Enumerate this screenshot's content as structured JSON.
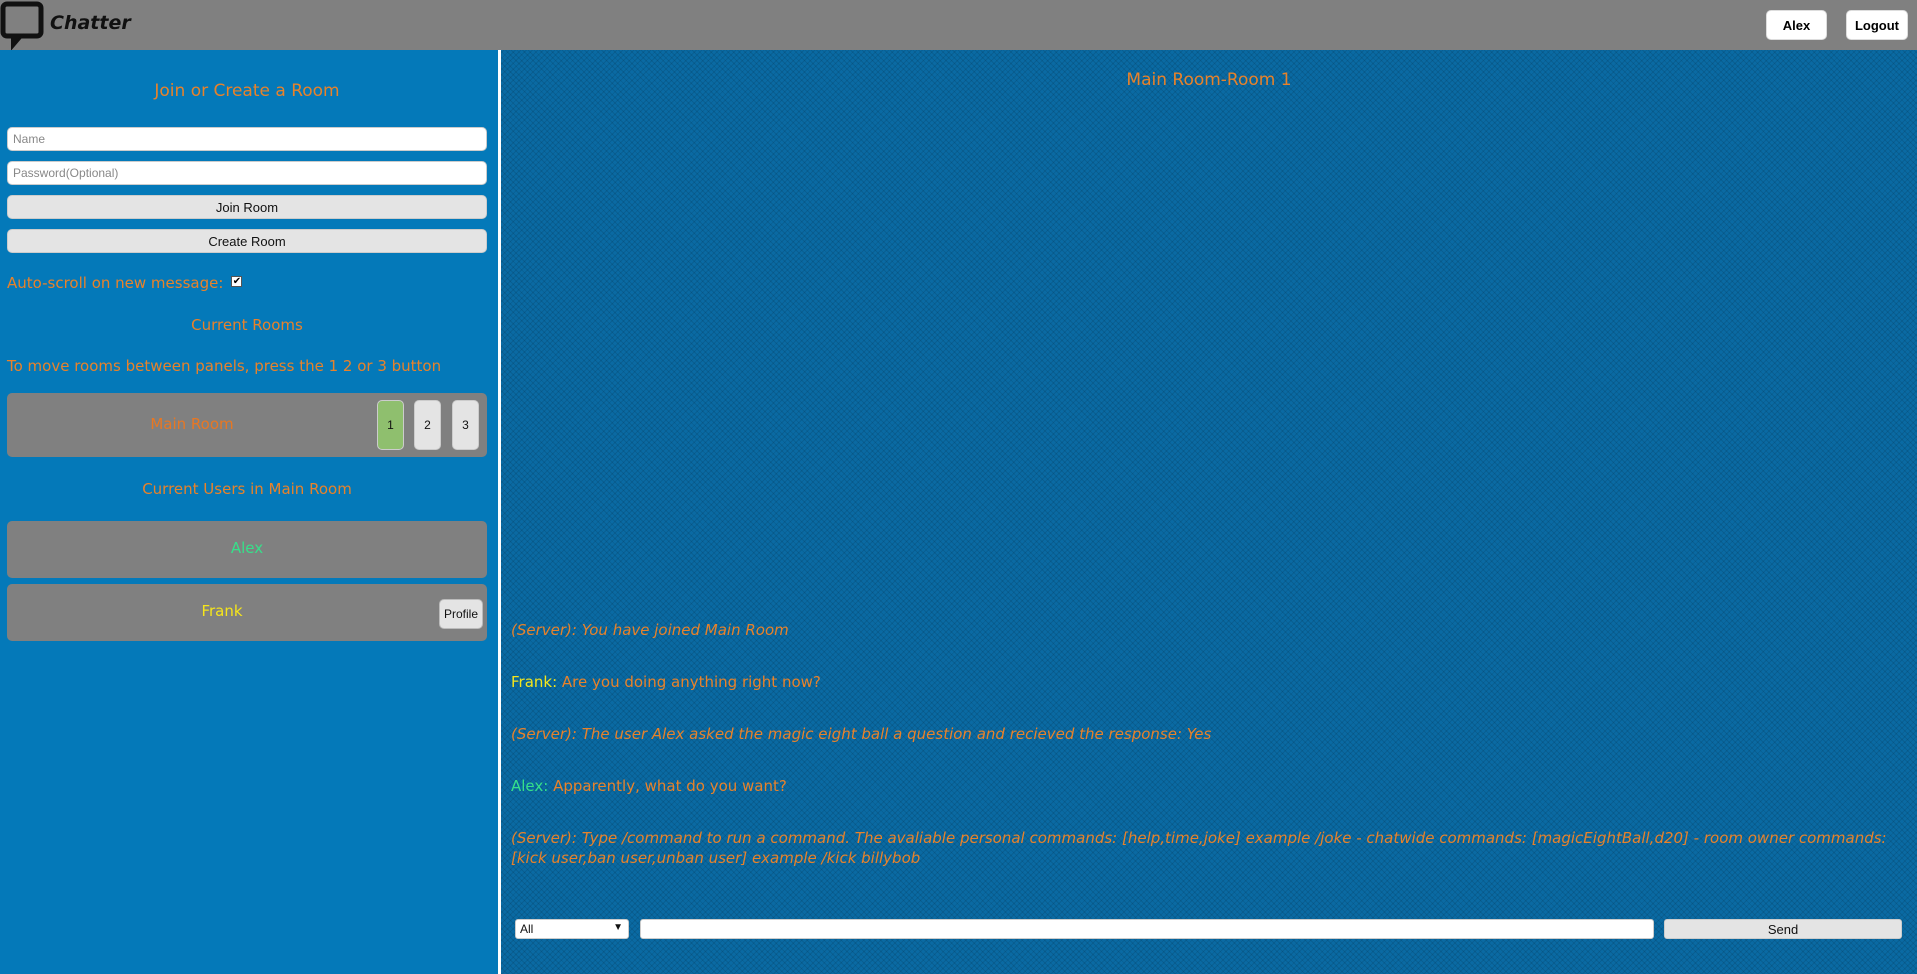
{
  "header": {
    "logo_text": "Chatter",
    "user_button": "Alex",
    "logout_button": "Logout"
  },
  "sidebar": {
    "join_title": "Join or Create a Room",
    "name_placeholder": "Name",
    "password_placeholder": "Password(Optional)",
    "join_button": "Join Room",
    "create_button": "Create Room",
    "autoscroll_label": "Auto-scroll on new message:",
    "autoscroll_checked": true,
    "current_rooms_title": "Current Rooms",
    "move_info": "To move rooms between panels, press the 1 2 or 3 button",
    "rooms": [
      {
        "name": "Main Room",
        "panel_buttons": [
          "1",
          "2",
          "3"
        ],
        "active_panel": "1"
      }
    ],
    "users_title": "Current Users in Main Room",
    "users": [
      {
        "name": "Alex",
        "color": "#36e08a"
      },
      {
        "name": "Frank",
        "color": "#f5e51b",
        "profile_button": "Profile"
      }
    ]
  },
  "chat": {
    "room_title": "Main Room-Room 1",
    "messages": [
      {
        "sender": "(Server):",
        "text": " You have joined Main Room",
        "server": true
      },
      {
        "sender": "Frank:",
        "text": " Are you doing anything right now?",
        "server": false
      },
      {
        "sender": "(Server):",
        "text": " The user Alex asked the magic eight ball a question and recieved the response: Yes",
        "server": true
      },
      {
        "sender": "Alex:",
        "text": " Apparently, what do you want?",
        "server": false
      },
      {
        "sender": "(Server):",
        "text": " Type /command to run a command. The avaliable personal commands: [help,time,joke] example /joke - chatwide commands: [magicEightBall,d20] - room owner commands: [kick user,ban user,unban user] example /kick billybob",
        "server": true
      }
    ],
    "recipient_select": "All",
    "send_button": "Send"
  },
  "colors": {
    "background": "#0479b9",
    "header": "#808080",
    "accent_orange": "#e8822a",
    "active_panel_green": "#8fbf6e"
  }
}
